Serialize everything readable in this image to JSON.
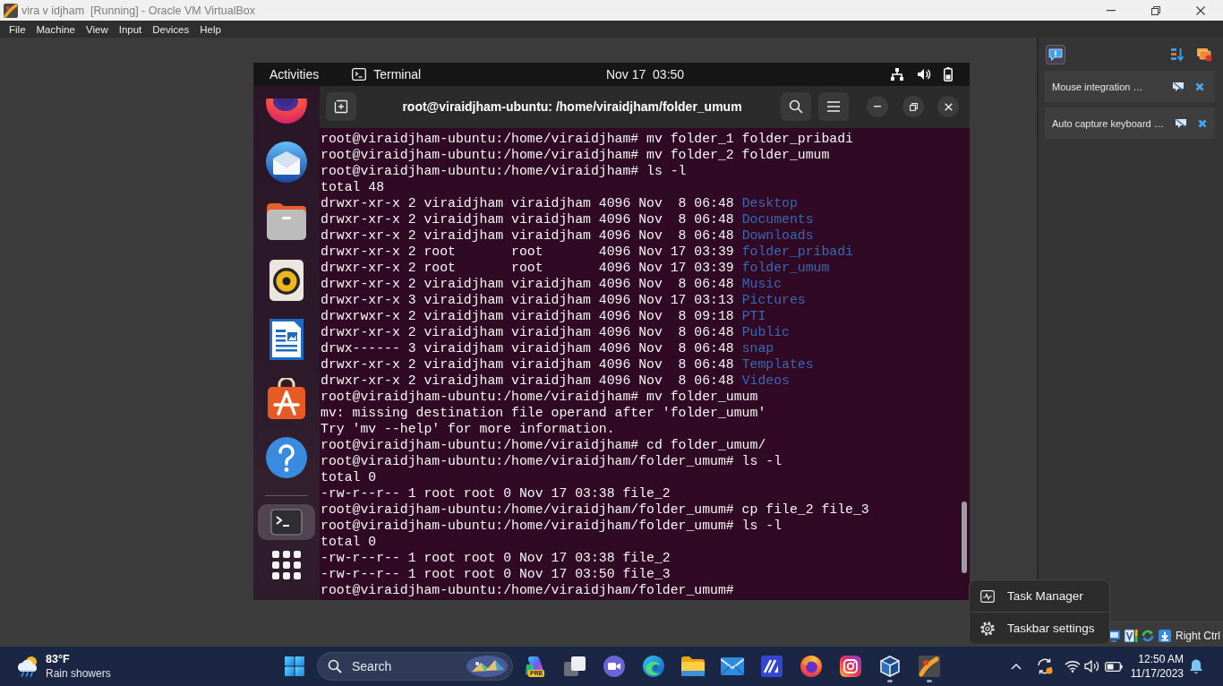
{
  "window": {
    "title": "vira v idjham  [Running] - Oracle VM VirtualBox"
  },
  "menu_bar": [
    "File",
    "Machine",
    "View",
    "Input",
    "Devices",
    "Help"
  ],
  "guest": {
    "top_bar": {
      "activities": "Activities",
      "app": "Terminal",
      "clock": "Nov 17  03:50"
    },
    "dock": [
      {
        "kind": "browser",
        "active": false
      },
      {
        "kind": "mail",
        "active": false
      },
      {
        "kind": "files",
        "active": false
      },
      {
        "kind": "music",
        "active": false
      },
      {
        "kind": "writer",
        "active": false
      },
      {
        "kind": "store",
        "active": false
      },
      {
        "kind": "help",
        "active": false
      },
      {
        "kind": "separator"
      },
      {
        "kind": "terminal",
        "active": true
      },
      {
        "kind": "apps",
        "active": false
      }
    ],
    "terminal": {
      "title": "root@viraidjham-ubuntu: /home/viraidjham/folder_umum",
      "lines": [
        {
          "kind": "text",
          "text": "root@viraidjham-ubuntu:/home/viraidjham# mv folder_1 folder_pribadi"
        },
        {
          "kind": "text",
          "text": "root@viraidjham-ubuntu:/home/viraidjham# mv folder_2 folder_umum"
        },
        {
          "kind": "text",
          "text": "root@viraidjham-ubuntu:/home/viraidjham# ls -l"
        },
        {
          "kind": "text",
          "text": "total 48"
        },
        {
          "kind": "entry",
          "details": "drwxr-xr-x 2 viraidjham viraidjham 4096 Nov  8 06:48",
          "name": "Desktop"
        },
        {
          "kind": "entry",
          "details": "drwxr-xr-x 2 viraidjham viraidjham 4096 Nov  8 06:48",
          "name": "Documents"
        },
        {
          "kind": "entry",
          "details": "drwxr-xr-x 2 viraidjham viraidjham 4096 Nov  8 06:48",
          "name": "Downloads"
        },
        {
          "kind": "entry",
          "details": "drwxr-xr-x 2 root       root       4096 Nov 17 03:39",
          "name": "folder_pribadi"
        },
        {
          "kind": "entry",
          "details": "drwxr-xr-x 2 root       root       4096 Nov 17 03:39",
          "name": "folder_umum"
        },
        {
          "kind": "entry",
          "details": "drwxr-xr-x 2 viraidjham viraidjham 4096 Nov  8 06:48",
          "name": "Music"
        },
        {
          "kind": "entry",
          "details": "drwxr-xr-x 3 viraidjham viraidjham 4096 Nov 17 03:13",
          "name": "Pictures"
        },
        {
          "kind": "entry",
          "details": "drwxrwxr-x 2 viraidjham viraidjham 4096 Nov  8 09:18",
          "name": "PTI"
        },
        {
          "kind": "entry",
          "details": "drwxr-xr-x 2 viraidjham viraidjham 4096 Nov  8 06:48",
          "name": "Public"
        },
        {
          "kind": "entry",
          "details": "drwx------ 3 viraidjham viraidjham 4096 Nov  8 06:48",
          "name": "snap"
        },
        {
          "kind": "entry",
          "details": "drwxr-xr-x 2 viraidjham viraidjham 4096 Nov  8 06:48",
          "name": "Templates"
        },
        {
          "kind": "entry",
          "details": "drwxr-xr-x 2 viraidjham viraidjham 4096 Nov  8 06:48",
          "name": "Videos"
        },
        {
          "kind": "text",
          "text": "root@viraidjham-ubuntu:/home/viraidjham# mv folder_umum"
        },
        {
          "kind": "text",
          "text": "mv: missing destination file operand after 'folder_umum'"
        },
        {
          "kind": "text",
          "text": "Try 'mv --help' for more information."
        },
        {
          "kind": "text",
          "text": "root@viraidjham-ubuntu:/home/viraidjham# cd folder_umum/"
        },
        {
          "kind": "text",
          "text": "root@viraidjham-ubuntu:/home/viraidjham/folder_umum# ls -l"
        },
        {
          "kind": "text",
          "text": "total 0"
        },
        {
          "kind": "text",
          "text": "-rw-r--r-- 1 root root 0 Nov 17 03:38 file_2"
        },
        {
          "kind": "text",
          "text": "root@viraidjham-ubuntu:/home/viraidjham/folder_umum# cp file_2 file_3"
        },
        {
          "kind": "text",
          "text": "root@viraidjham-ubuntu:/home/viraidjham/folder_umum# ls -l"
        },
        {
          "kind": "text",
          "text": "total 0"
        },
        {
          "kind": "text",
          "text": "-rw-r--r-- 1 root root 0 Nov 17 03:38 file_2"
        },
        {
          "kind": "text",
          "text": "-rw-r--r-- 1 root root 0 Nov 17 03:50 file_3"
        },
        {
          "kind": "text",
          "text": "root@viraidjham-ubuntu:/home/viraidjham/folder_umum#"
        }
      ]
    }
  },
  "notification_center": {
    "notifications": [
      {
        "text": "Mouse integration …"
      },
      {
        "text": "Auto capture keyboard …"
      }
    ]
  },
  "status_bar": {
    "host_key": "Right Ctrl"
  },
  "context_menu": [
    {
      "kind": "task-manager",
      "label": "Task Manager"
    },
    {
      "kind": "settings",
      "label": "Taskbar settings"
    }
  ],
  "taskbar": {
    "weather": {
      "temperature": "83°F",
      "condition": "Rain showers"
    },
    "search": {
      "placeholder": "Search"
    },
    "apps": [
      {
        "kind": "copilot",
        "badge": "PRE",
        "running": false
      },
      {
        "kind": "task-view",
        "running": false
      },
      {
        "kind": "video",
        "running": false
      },
      {
        "kind": "edge",
        "running": false
      },
      {
        "kind": "explorer",
        "running": false
      },
      {
        "kind": "mail",
        "running": false
      },
      {
        "kind": "slash",
        "running": false
      },
      {
        "kind": "firefox",
        "running": false
      },
      {
        "kind": "instagram",
        "running": false
      },
      {
        "kind": "virtualbox",
        "running": true
      },
      {
        "kind": "vm",
        "running": true
      }
    ],
    "clock": {
      "time": "12:50 AM",
      "date": "11/17/2023"
    }
  }
}
